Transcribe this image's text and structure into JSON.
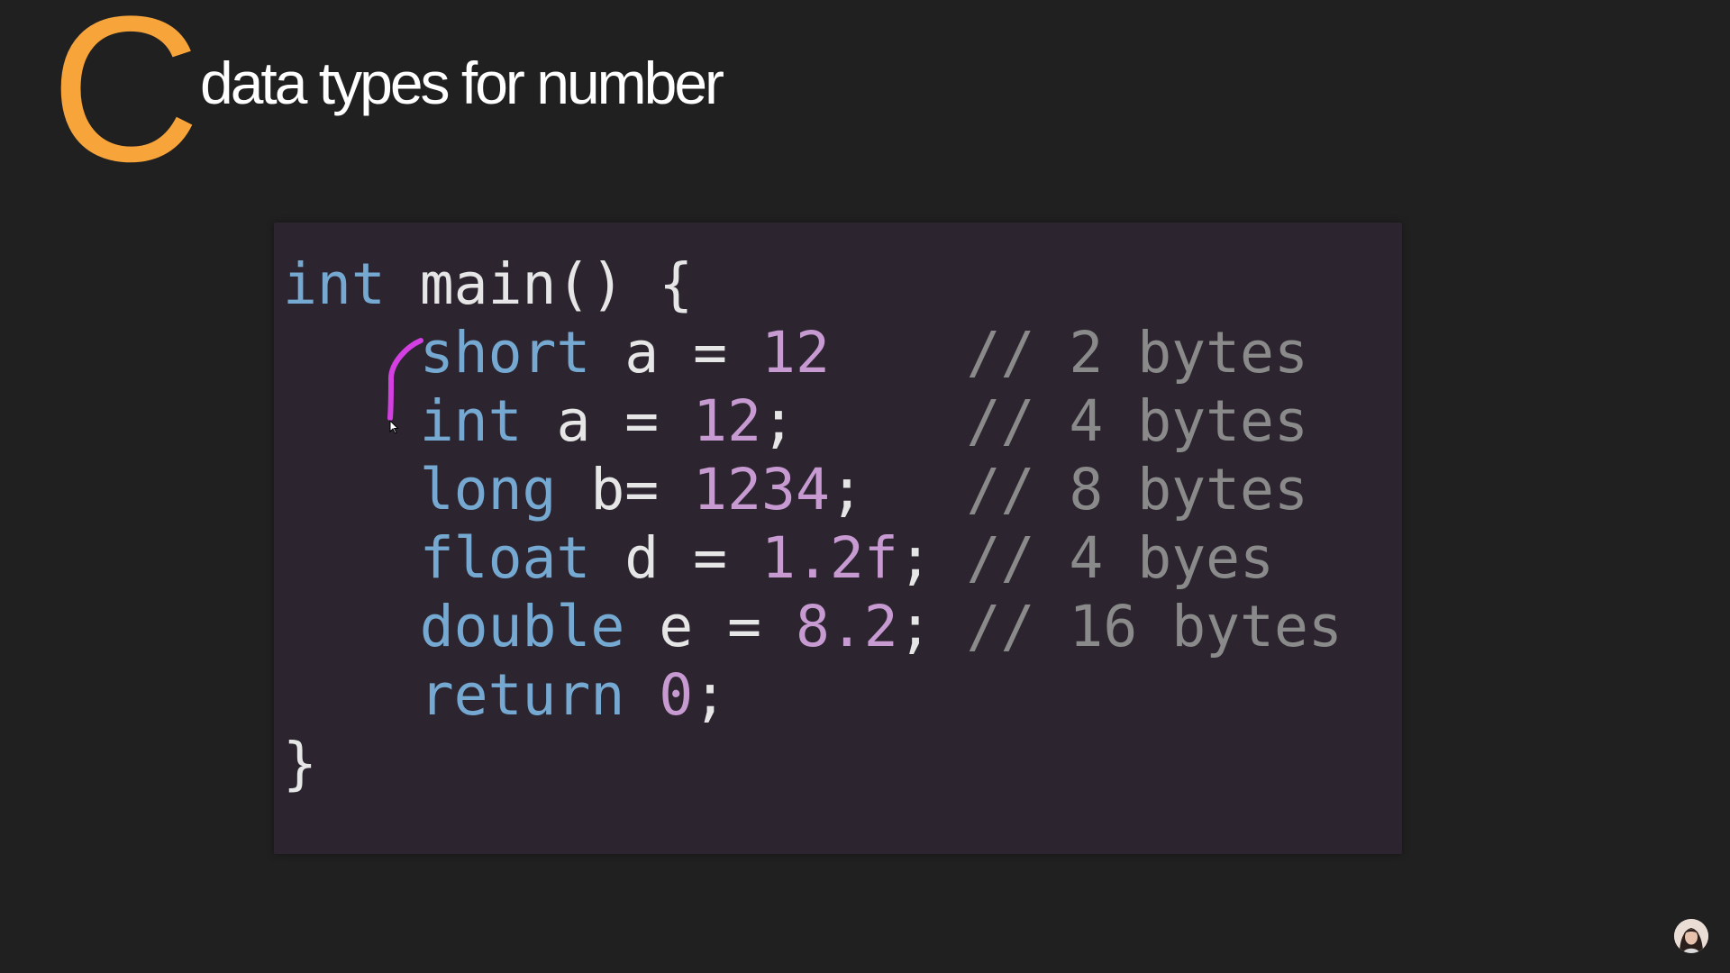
{
  "slide": {
    "logo_letter": "C",
    "title": "data types for number"
  },
  "code": {
    "line1": {
      "kw": "int",
      "rest": " main() {"
    },
    "line2": {
      "indent": "    ",
      "kw": "short",
      "mid": " a = ",
      "num": "12",
      "punct": "",
      "pad": "    ",
      "comment": "// 2 bytes"
    },
    "line3": {
      "indent": "    ",
      "kw": "int",
      "mid": " a = ",
      "num": "12",
      "punct": ";",
      "pad": "     ",
      "comment": "// 4 bytes"
    },
    "line4": {
      "indent": "    ",
      "kw": "long",
      "mid": " b= ",
      "num": "1234",
      "punct": ";",
      "pad": "   ",
      "comment": "// 8 bytes"
    },
    "line5": {
      "indent": "    ",
      "kw": "float",
      "mid": " d = ",
      "num": "1.2f",
      "punct": ";",
      "pad": " ",
      "comment": "// 4 byes"
    },
    "line6": {
      "indent": "    ",
      "kw": "double",
      "mid": " e = ",
      "num": "8.2",
      "punct": ";",
      "pad": " ",
      "comment": "// 16 bytes"
    },
    "line7": {
      "indent": "    ",
      "kw": "return",
      "mid": " ",
      "num": "0",
      "punct": ";"
    },
    "line8": {
      "brace": "}"
    }
  },
  "colors": {
    "background": "#202020",
    "logo": "#f7a43b",
    "panel": "#2c2530",
    "keyword": "#76a9d2",
    "number": "#c79bd1",
    "comment": "#8a8a8a",
    "annotation": "#d33fe0"
  },
  "icons": {
    "annotation": "pen-stroke-icon",
    "cursor": "mouse-cursor-icon",
    "avatar": "presenter-avatar-icon"
  }
}
